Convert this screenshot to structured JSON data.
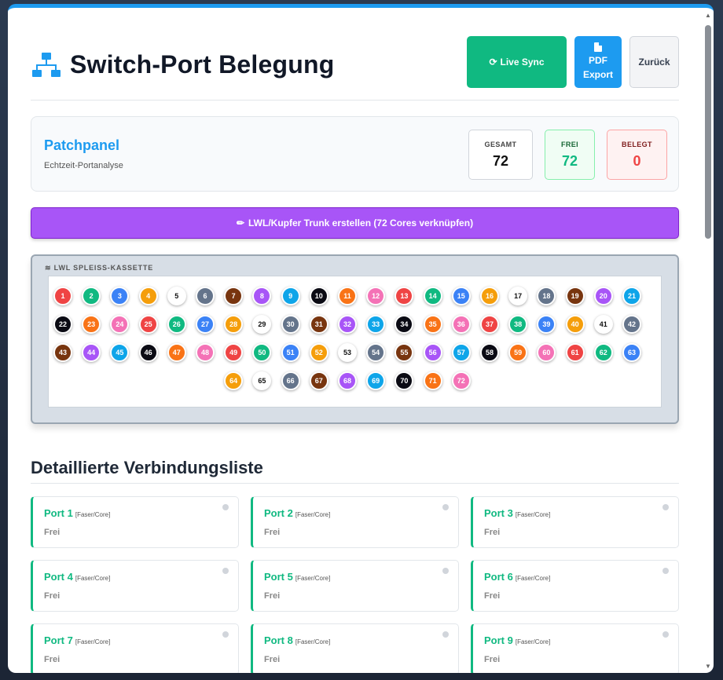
{
  "header": {
    "title": "Switch-Port Belegung",
    "title_icon": "network-icon",
    "buttons": {
      "sync": "Live Sync",
      "pdf_line1": "PDF",
      "pdf_line2": "Export",
      "back": "Zurück"
    }
  },
  "panel": {
    "title": "Patchpanel",
    "subtitle": "Echtzeit-Portanalyse",
    "stats": {
      "total_label": "GESAMT",
      "total_value": "72",
      "free_label": "FREI",
      "free_value": "72",
      "used_label": "BELEGT",
      "used_value": "0"
    }
  },
  "trunk_button": "LWL/Kupfer Trunk erstellen (72 Cores verknüpfen)",
  "cassette": {
    "label": "LWL SPLEISS-KASSETTE",
    "fiber_colors": [
      "#ef4444",
      "#10b981",
      "#3b82f6",
      "#f59e0b",
      "#ffffff",
      "#64748b",
      "#78350f",
      "#a855f7",
      "#0ea5e9",
      "#0b0b14",
      "#f97316",
      "#f472b6"
    ],
    "ports": [
      "1",
      "2",
      "3",
      "4",
      "5",
      "6",
      "7",
      "8",
      "9",
      "10",
      "11",
      "12",
      "13",
      "14",
      "15",
      "16",
      "17",
      "18",
      "19",
      "20",
      "21",
      "22",
      "23",
      "24",
      "25",
      "26",
      "27",
      "28",
      "29",
      "30",
      "31",
      "32",
      "33",
      "34",
      "35",
      "36",
      "37",
      "38",
      "39",
      "40",
      "41",
      "42",
      "43",
      "44",
      "45",
      "46",
      "47",
      "48",
      "49",
      "50",
      "51",
      "52",
      "53",
      "54",
      "55",
      "56",
      "57",
      "58",
      "59",
      "60",
      "61",
      "62",
      "63",
      "64",
      "65",
      "66",
      "67",
      "68",
      "69",
      "70",
      "71",
      "72"
    ]
  },
  "details": {
    "title": "Detaillierte Verbindungsliste",
    "tag": "[Faser/Core]",
    "cards": [
      {
        "label": "Port 1",
        "status": "Frei"
      },
      {
        "label": "Port 2",
        "status": "Frei"
      },
      {
        "label": "Port 3",
        "status": "Frei"
      },
      {
        "label": "Port 4",
        "status": "Frei"
      },
      {
        "label": "Port 5",
        "status": "Frei"
      },
      {
        "label": "Port 6",
        "status": "Frei"
      },
      {
        "label": "Port 7",
        "status": "Frei"
      },
      {
        "label": "Port 8",
        "status": "Frei"
      },
      {
        "label": "Port 9",
        "status": "Frei"
      }
    ]
  }
}
